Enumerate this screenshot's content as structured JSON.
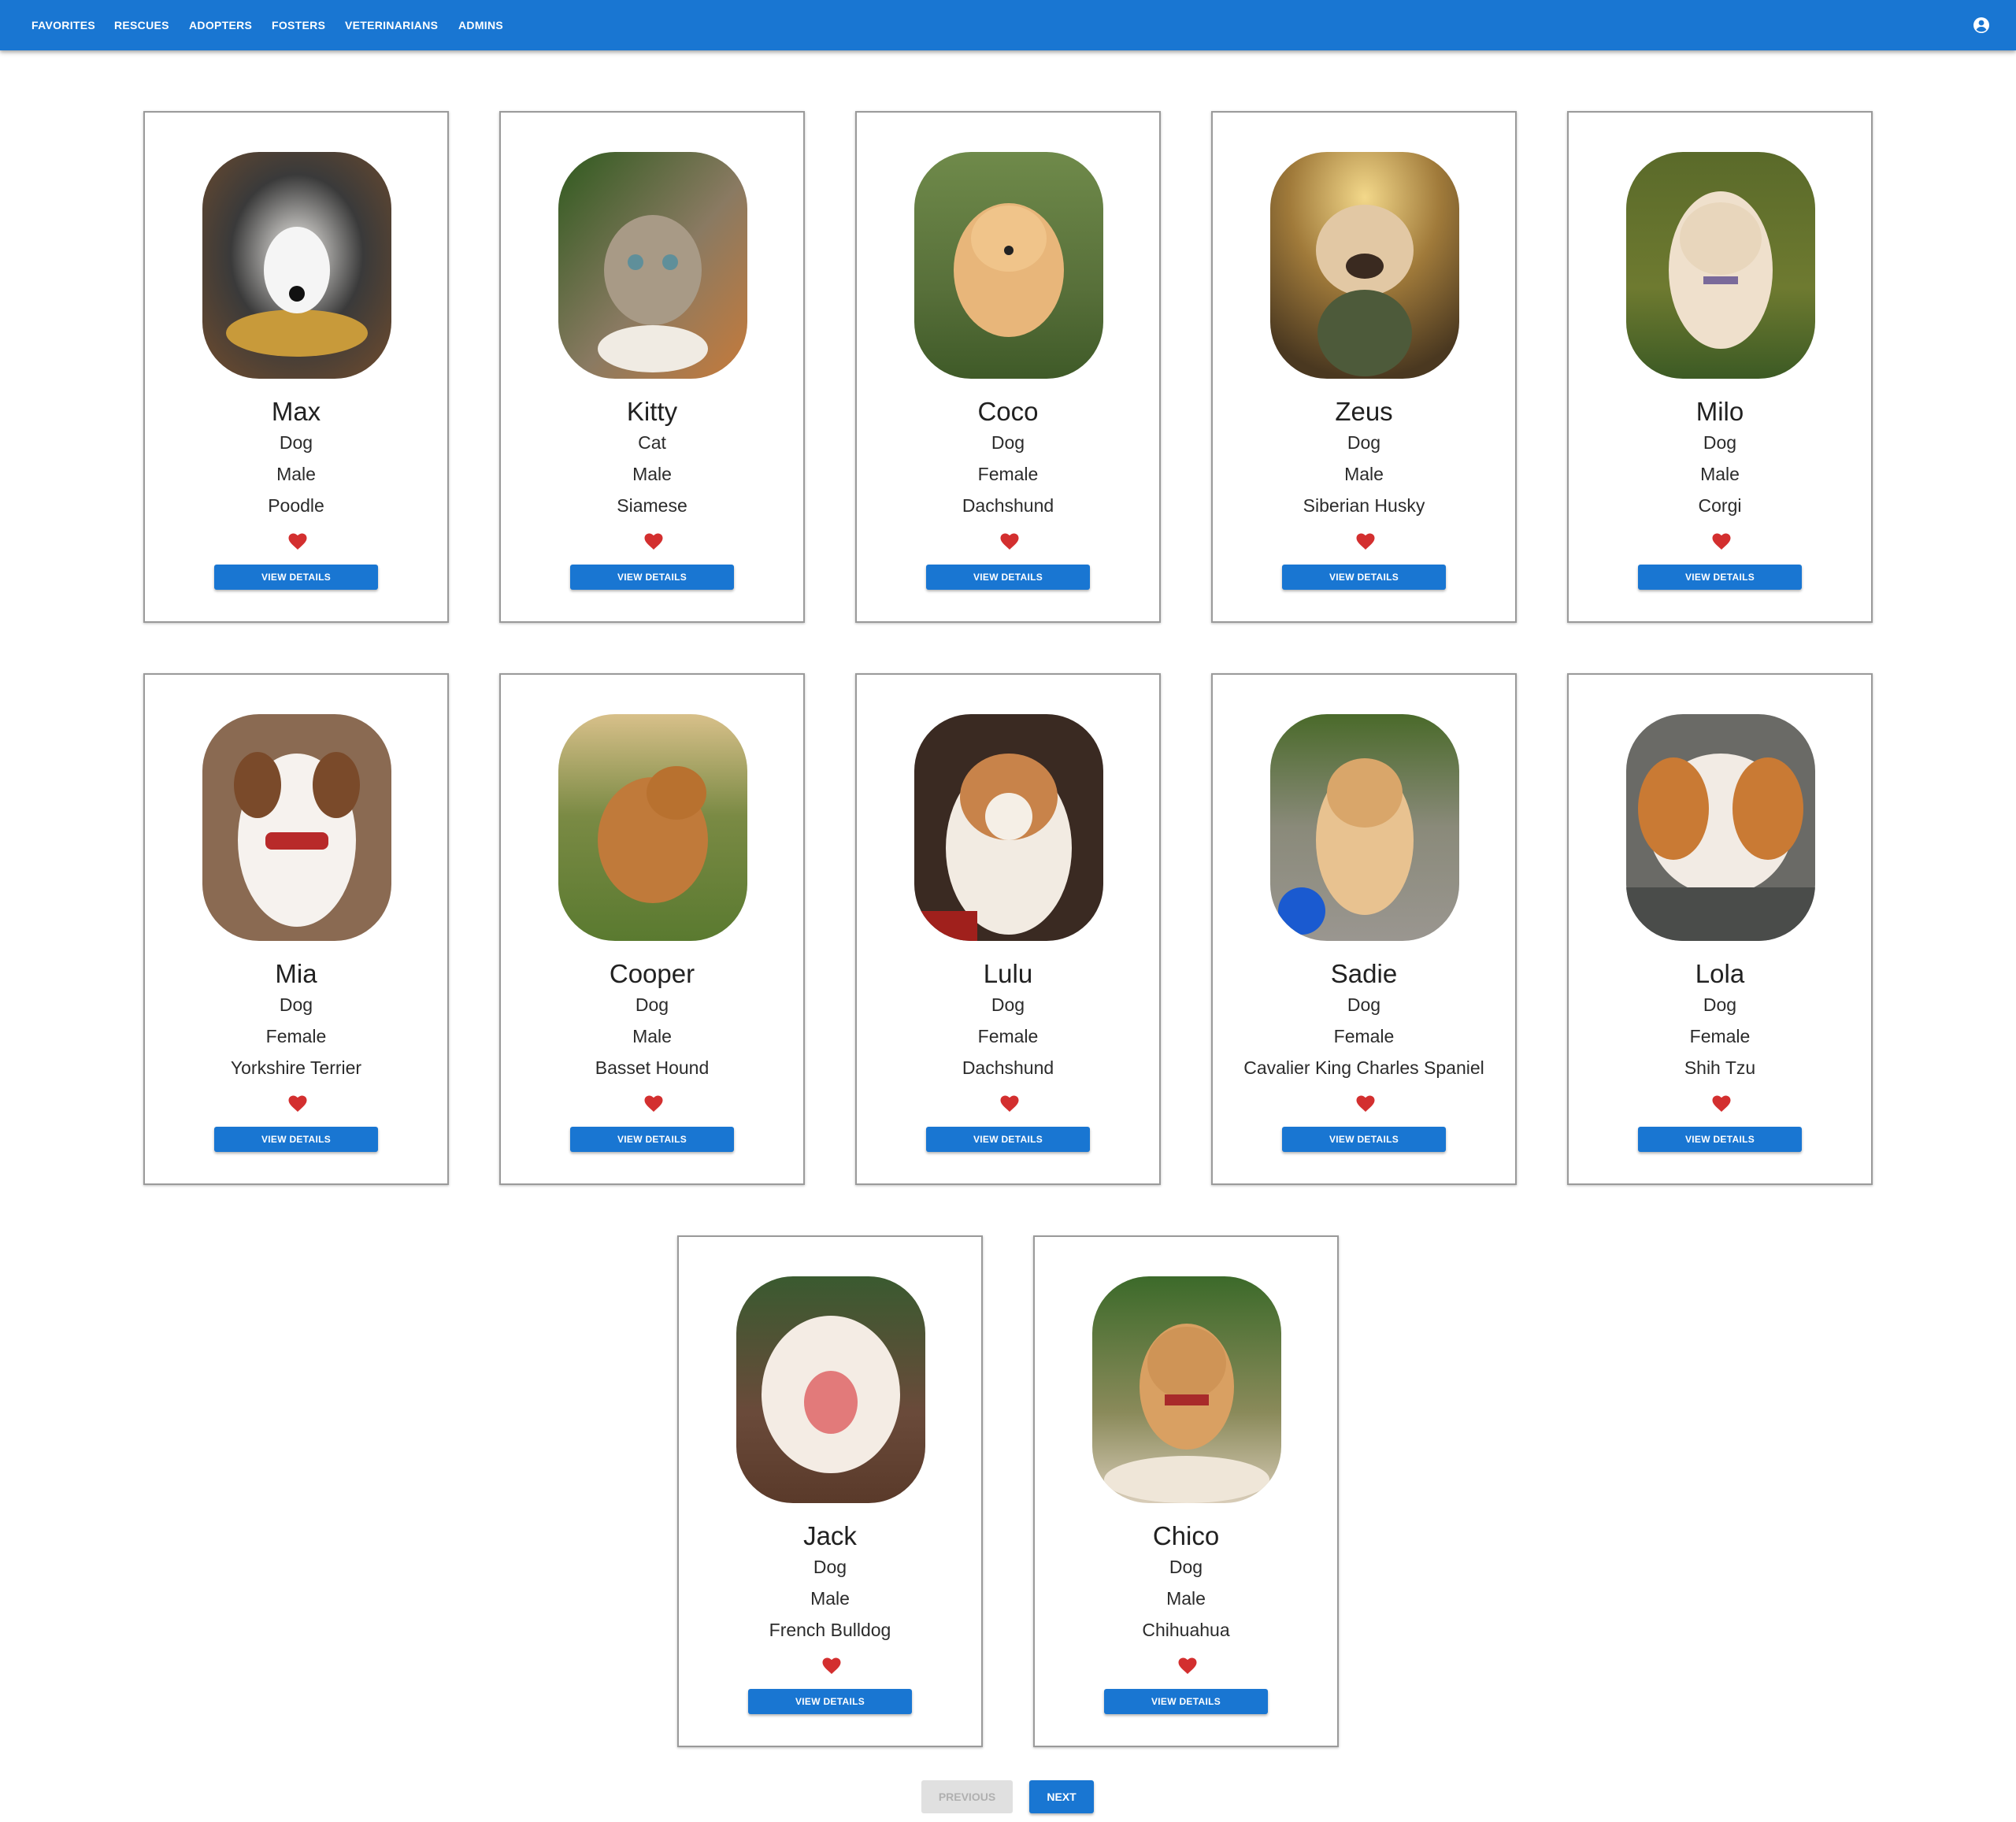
{
  "nav": {
    "links": [
      "Favorites",
      "Rescues",
      "Adopters",
      "Fosters",
      "Veterinarians",
      "Admins"
    ],
    "account_icon": "account-circle-icon"
  },
  "colors": {
    "primary": "#1976d2",
    "favorite": "#d32f2f",
    "disabled_bg": "#e0e0e0",
    "disabled_text": "#b0b0b0"
  },
  "pets": [
    {
      "name": "Max",
      "species": "Dog",
      "gender": "Male",
      "breed": "Poodle",
      "favorite": true,
      "action": "View Details",
      "photo": "puppy-photo"
    },
    {
      "name": "Kitty",
      "species": "Cat",
      "gender": "Male",
      "breed": "Siamese",
      "favorite": true,
      "action": "View Details",
      "photo": "kitten-photo"
    },
    {
      "name": "Coco",
      "species": "Dog",
      "gender": "Female",
      "breed": "Dachshund",
      "favorite": true,
      "action": "View Details",
      "photo": "puppy-photo"
    },
    {
      "name": "Zeus",
      "species": "Dog",
      "gender": "Male",
      "breed": "Siberian Husky",
      "favorite": true,
      "action": "View Details",
      "photo": "puppy-photo"
    },
    {
      "name": "Milo",
      "species": "Dog",
      "gender": "Male",
      "breed": "Corgi",
      "favorite": true,
      "action": "View Details",
      "photo": "puppy-photo"
    },
    {
      "name": "Mia",
      "species": "Dog",
      "gender": "Female",
      "breed": "Yorkshire Terrier",
      "favorite": true,
      "action": "View Details",
      "photo": "puppy-photo"
    },
    {
      "name": "Cooper",
      "species": "Dog",
      "gender": "Male",
      "breed": "Basset Hound",
      "favorite": true,
      "action": "View Details",
      "photo": "dog-photo"
    },
    {
      "name": "Lulu",
      "species": "Dog",
      "gender": "Female",
      "breed": "Dachshund",
      "favorite": true,
      "action": "View Details",
      "photo": "puppy-photo"
    },
    {
      "name": "Sadie",
      "species": "Dog",
      "gender": "Female",
      "breed": "Cavalier King Charles Spaniel",
      "favorite": true,
      "action": "View Details",
      "photo": "puppy-photo"
    },
    {
      "name": "Lola",
      "species": "Dog",
      "gender": "Female",
      "breed": "Shih Tzu",
      "favorite": true,
      "action": "View Details",
      "photo": "puppy-photo"
    },
    {
      "name": "Jack",
      "species": "Dog",
      "gender": "Male",
      "breed": "French Bulldog",
      "favorite": true,
      "action": "View Details",
      "photo": "puppy-photo"
    },
    {
      "name": "Chico",
      "species": "Dog",
      "gender": "Male",
      "breed": "Chihuahua",
      "favorite": true,
      "action": "View Details",
      "photo": "puppy-photo"
    }
  ],
  "pagination": {
    "previous_label": "Previous",
    "previous_disabled": true,
    "next_label": "Next",
    "next_disabled": false
  }
}
